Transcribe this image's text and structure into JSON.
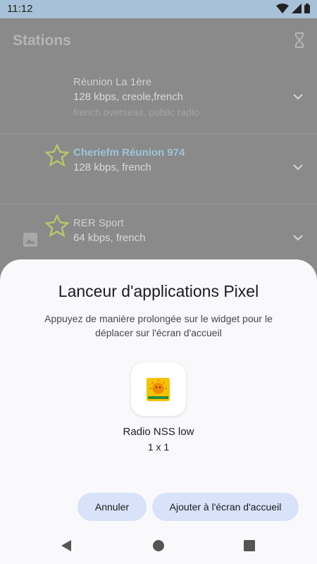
{
  "status_bar": {
    "time": "11:12"
  },
  "app_bar": {
    "title": "Stations"
  },
  "stations": [
    {
      "name": "Réunion La 1ère",
      "details": "128 kbps, creole,french",
      "tags": "french overseas, public radio",
      "favorite": false
    },
    {
      "name": "Cheriefm Réunion 974",
      "details": "128 kbps, french",
      "favorite": true
    },
    {
      "name": "RER Sport",
      "details": "64 kbps, french",
      "favorite": true
    }
  ],
  "sheet": {
    "title": "Lanceur d'applications Pixel",
    "description": "Appuyez de manière prolongée sur le widget pour le déplacer sur l'écran d'accueil",
    "widget_name": "Radio NSS low",
    "widget_size": "1 x 1",
    "cancel_label": "Annuler",
    "add_label": "Ajouter à l'écran d'accueil"
  },
  "colors": {
    "scrim": "#8a8a8a",
    "sheet_bg": "#f9f9fc",
    "button_bg": "#d8e2f9",
    "status_bar": "#a7c2d8",
    "favorite_accent": "#9ec3d8"
  }
}
